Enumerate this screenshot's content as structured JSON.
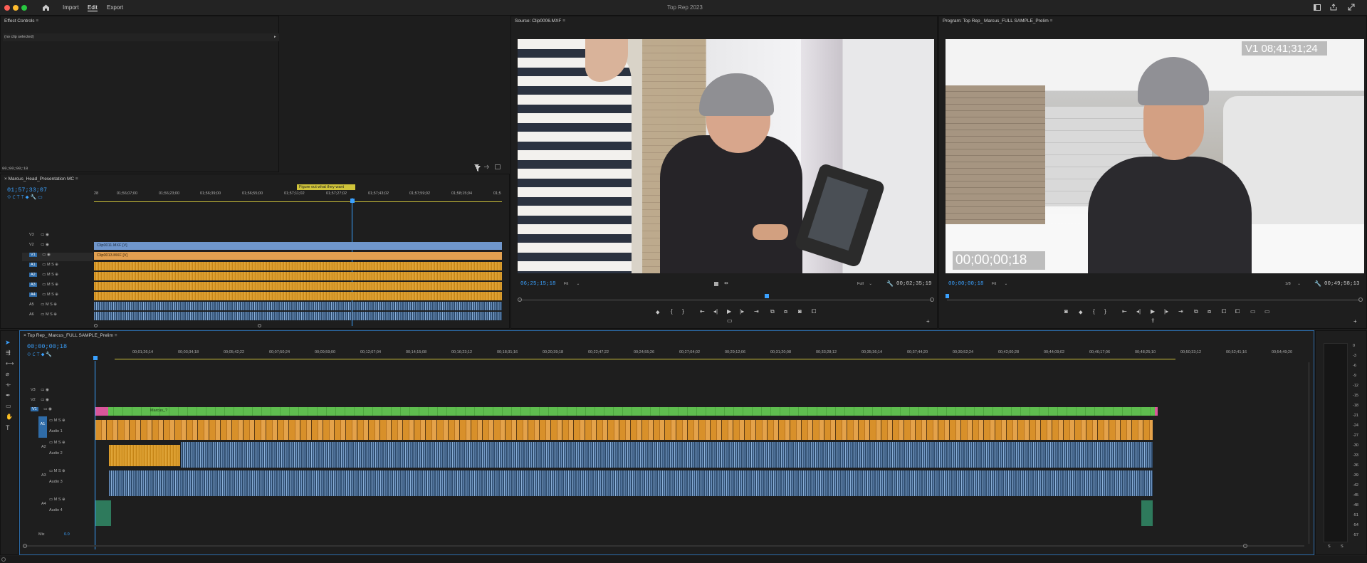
{
  "app": {
    "title": "Top Rep 2023",
    "nav": [
      "Import",
      "Edit",
      "Export"
    ],
    "active_nav": "Edit"
  },
  "effect_controls": {
    "title": "Effect Controls",
    "no_clip": "(no clip selected)",
    "timecode": "00;00;00;18"
  },
  "source_monitor": {
    "title": "Source: Clip0006.MXF",
    "timecode_in": "06;25;15;18",
    "fit": "Fit",
    "quality": "Full",
    "duration": "00;02;35;19"
  },
  "program_monitor": {
    "title": "Program: Top Rep_ Marcus_FULL SAMPLE_Prelim",
    "timecode": "00;00;00;18",
    "fit": "Fit",
    "quality": "1/8",
    "duration": "00;49;58;13",
    "overlay_track_tc": "V1 08;41;31;24",
    "overlay_program_tc": "00;00;00;18"
  },
  "mc_sequence": {
    "title": "Marcus_Head_Presentation MC",
    "timecode": "01;57;33;07",
    "marker_label": "Figure out what they want",
    "ruler": [
      "28",
      "01;56;07;00",
      "01;56;23;00",
      "01;56;39;00",
      "01;56;55;00",
      "01;57;11;02",
      "01;57;27;02",
      "01;57;43;02",
      "01;57;59;02",
      "01;58;15;04",
      "01;5"
    ],
    "video_tracks": [
      "V3",
      "V2",
      "V1"
    ],
    "audio_tracks": [
      "A1",
      "A2",
      "A3",
      "A4",
      "A5",
      "A6"
    ],
    "clip_v2": "Clip0011.MXF [V]",
    "clip_v1": "Clip0013.MXF [V]"
  },
  "timeline": {
    "title": "Top Rep_ Marcus_FULL SAMPLE_Prelim",
    "timecode": "00;00;00;18",
    "ruler": [
      "00;01;26;14",
      "00;03;34;18",
      "00;05;42;22",
      "00;07;50;24",
      "00;09;59;00",
      "00;12;07;04",
      "00;14;15;08",
      "00;16;23;12",
      "00;18;31;16",
      "00;20;39;18",
      "00;22;47;22",
      "00;24;55;26",
      "00;27;04;02",
      "00;29;12;06",
      "00;31;20;08",
      "00;33;28;12",
      "00;35;36;14",
      "00;37;44;20",
      "00;39;52;24",
      "00;42;00;28",
      "00;44;09;02",
      "00;46;17;06",
      "00;48;25;10",
      "00;50;33;12",
      "00;52;41;16",
      "00;54;49;20"
    ],
    "video_tracks": [
      "V3",
      "V2",
      "V1"
    ],
    "audio_tracks": [
      {
        "id": "A1",
        "name": "Audio 1"
      },
      {
        "id": "A2",
        "name": "Audio 2"
      },
      {
        "id": "A3",
        "name": "Audio 3"
      },
      {
        "id": "A4",
        "name": "Audio 4"
      }
    ],
    "mix_label": "Mix",
    "mix_value": "0.0",
    "v1_clip_label": "Marcus_?"
  },
  "meter": {
    "scale": [
      "0",
      "-3",
      "-6",
      "-9",
      "-12",
      "-15",
      "-18",
      "-21",
      "-24",
      "-27",
      "-30",
      "-33",
      "-36",
      "-39",
      "-42",
      "-45",
      "-48",
      "-51",
      "-54",
      "-57"
    ],
    "solo": [
      "S",
      "S"
    ]
  },
  "colors": {
    "accent_blue": "#3aa1ff",
    "video_green": "#5fbd4f",
    "audio_orange": "#d99a2b",
    "audio_blue": "#6d93c0",
    "clip_purple": "#a88fe6"
  }
}
